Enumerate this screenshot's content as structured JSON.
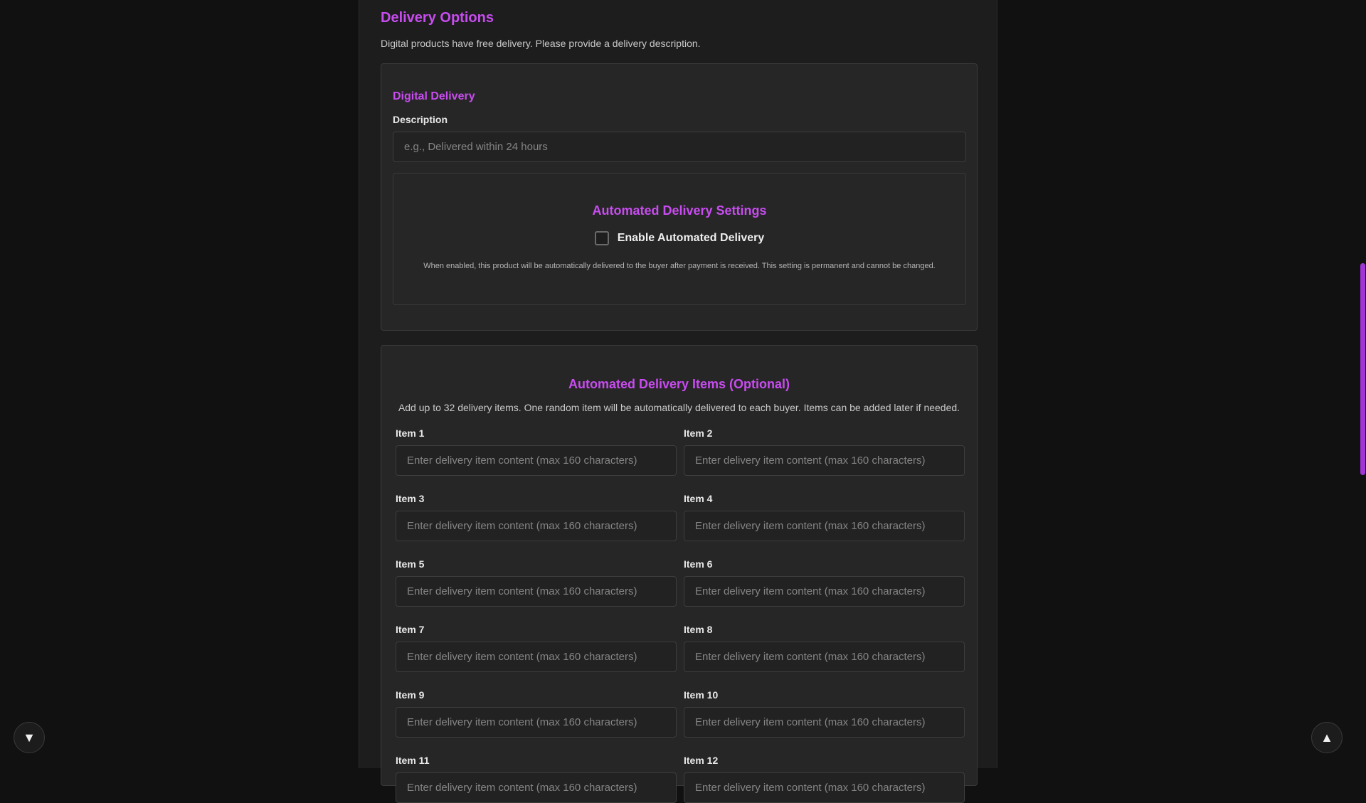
{
  "delivery": {
    "title": "Delivery Options",
    "description": "Digital products have free delivery. Please provide a delivery description."
  },
  "digital": {
    "title": "Digital Delivery",
    "description_label": "Description",
    "description_placeholder": "e.g., Delivered within 24 hours",
    "description_value": ""
  },
  "automation": {
    "title": "Automated Delivery Settings",
    "checkbox_label": "Enable Automated Delivery",
    "checkbox_checked": false,
    "note": "When enabled, this product will be automatically delivered to the buyer after payment is received. This setting is permanent and cannot be changed."
  },
  "items": {
    "title": "Automated Delivery Items (Optional)",
    "description": "Add up to 32 delivery items. One random item will be automatically delivered to each buyer. Items can be added later if needed.",
    "placeholder": "Enter delivery item content (max 160 characters)",
    "labels": [
      "Item 1",
      "Item 2",
      "Item 3",
      "Item 4",
      "Item 5",
      "Item 6",
      "Item 7",
      "Item 8",
      "Item 9",
      "Item 10",
      "Item 11",
      "Item 12"
    ]
  },
  "controls": {
    "scroll_down_icon": "▼",
    "scroll_up_icon": "▲"
  },
  "colors": {
    "accent": "#c84cf0",
    "background": "#111111",
    "panel": "#1d1d1d",
    "card": "#262626",
    "scroll_thumb": "#a036d8"
  }
}
